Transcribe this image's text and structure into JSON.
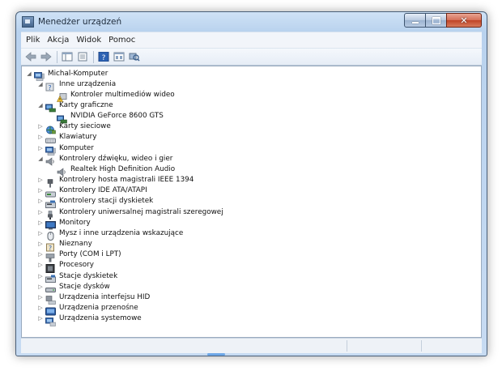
{
  "window": {
    "title": "Menedżer urządzeń"
  },
  "menu": [
    "Plik",
    "Akcja",
    "Widok",
    "Pomoc"
  ],
  "toolbar_icons": [
    "back-arrow-icon",
    "forward-arrow-icon",
    "show-hide-tree-icon",
    "properties-icon",
    "help-icon",
    "view-icon",
    "scan-hardware-icon"
  ],
  "tree": [
    {
      "label": "Michal-Komputer",
      "level": 0,
      "state": "expanded",
      "icon": "computer-icon"
    },
    {
      "label": "Inne urządzenia",
      "level": 1,
      "state": "expanded",
      "icon": "unknown-device-icon"
    },
    {
      "label": "Kontroler multimediów wideo",
      "level": 2,
      "state": "leaf",
      "icon": "warning-device-icon"
    },
    {
      "label": "Karty graficzne",
      "level": 1,
      "state": "expanded",
      "icon": "display-adapter-icon"
    },
    {
      "label": "NVIDIA GeForce 8600 GTS",
      "level": 2,
      "state": "leaf",
      "icon": "display-adapter-icon"
    },
    {
      "label": "Karty sieciowe",
      "level": 1,
      "state": "collapsed",
      "icon": "network-adapter-icon"
    },
    {
      "label": "Klawiatury",
      "level": 1,
      "state": "collapsed",
      "icon": "keyboard-icon"
    },
    {
      "label": "Komputer",
      "level": 1,
      "state": "collapsed",
      "icon": "computer-icon"
    },
    {
      "label": "Kontrolery dźwięku, wideo i gier",
      "level": 1,
      "state": "expanded",
      "icon": "speaker-icon"
    },
    {
      "label": "Realtek High Definition Audio",
      "level": 2,
      "state": "leaf",
      "icon": "speaker-icon"
    },
    {
      "label": "Kontrolery hosta magistrali IEEE 1394",
      "level": 1,
      "state": "collapsed",
      "icon": "plug-icon"
    },
    {
      "label": "Kontrolery IDE ATA/ATAPI",
      "level": 1,
      "state": "collapsed",
      "icon": "ide-controller-icon"
    },
    {
      "label": "Kontrolery stacji dyskietek",
      "level": 1,
      "state": "collapsed",
      "icon": "floppy-controller-icon"
    },
    {
      "label": "Kontrolery uniwersalnej magistrali szeregowej",
      "level": 1,
      "state": "collapsed",
      "icon": "usb-plug-icon"
    },
    {
      "label": "Monitory",
      "level": 1,
      "state": "collapsed",
      "icon": "monitor-icon"
    },
    {
      "label": "Mysz i inne urządzenia wskazujące",
      "level": 1,
      "state": "collapsed",
      "icon": "mouse-icon"
    },
    {
      "label": "Nieznany",
      "level": 1,
      "state": "collapsed",
      "icon": "unknown-icon"
    },
    {
      "label": "Porty (COM i LPT)",
      "level": 1,
      "state": "collapsed",
      "icon": "port-icon"
    },
    {
      "label": "Procesory",
      "level": 1,
      "state": "collapsed",
      "icon": "processor-icon"
    },
    {
      "label": "Stacje dyskietek",
      "level": 1,
      "state": "collapsed",
      "icon": "floppy-drive-icon"
    },
    {
      "label": "Stacje dysków",
      "level": 1,
      "state": "collapsed",
      "icon": "disk-drive-icon"
    },
    {
      "label": "Urządzenia interfejsu HID",
      "level": 1,
      "state": "collapsed",
      "icon": "hid-icon"
    },
    {
      "label": "Urządzenia przenośne",
      "level": 1,
      "state": "collapsed",
      "icon": "portable-device-icon"
    },
    {
      "label": "Urządzenia systemowe",
      "level": 1,
      "state": "collapsed",
      "icon": "system-device-icon"
    }
  ]
}
